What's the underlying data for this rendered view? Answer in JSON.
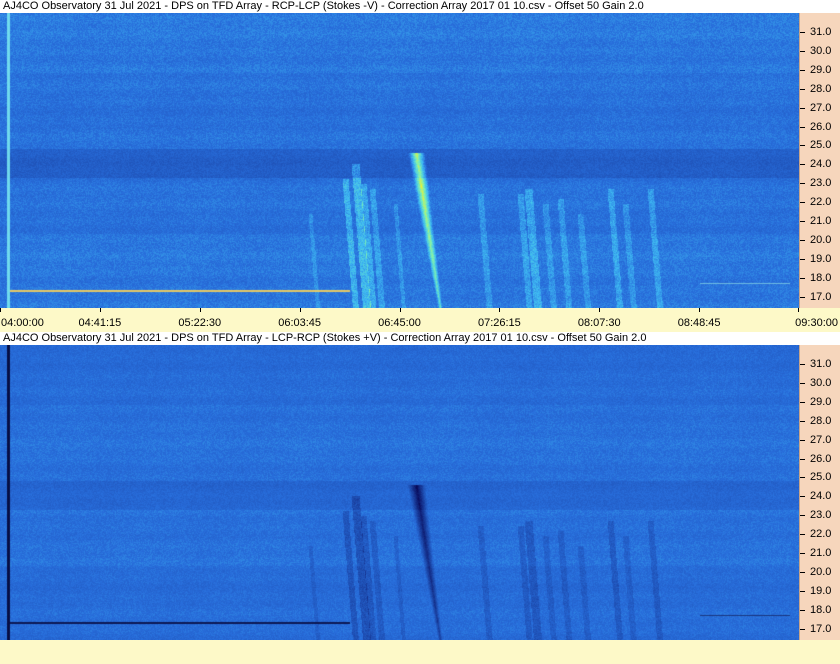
{
  "panels": [
    {
      "title": "AJ4CO Observatory 31 Jul 2021  -  DPS on TFD Array  -  RCP-LCP (Stokes -V)  -  Correction Array 2017 01 10.csv  -  Offset 50  Gain 2.0",
      "polarity": "positive",
      "freq_labels": [
        "31.0",
        "30.0",
        "29.0",
        "28.0",
        "27.0",
        "26.0",
        "25.0",
        "24.0",
        "23.0",
        "22.0",
        "21.0",
        "20.0",
        "19.0",
        "18.0",
        "17.0"
      ],
      "time_labels": [
        "04:00:00",
        "04:41:15",
        "05:22:30",
        "06:03:45",
        "06:45:00",
        "07:26:15",
        "08:07:30",
        "08:48:45",
        "09:30:00"
      ]
    },
    {
      "title": "AJ4CO Observatory 31 Jul 2021  -  DPS on TFD Array  -  LCP-RCP (Stokes +V)  -  Correction Array 2017 01 10.csv  -  Offset 50  Gain 2.0",
      "polarity": "negative",
      "freq_labels": [
        "31.0",
        "30.0",
        "29.0",
        "28.0",
        "27.0",
        "26.0",
        "25.0",
        "24.0",
        "23.0",
        "22.0",
        "21.0",
        "20.0",
        "19.0",
        "18.0",
        "17.0"
      ],
      "time_labels": []
    }
  ],
  "colors": {
    "background_blue": "#2c6fe0",
    "axis_peach": "#f6d6bc",
    "axis_yellow": "#fdf9c8"
  }
}
